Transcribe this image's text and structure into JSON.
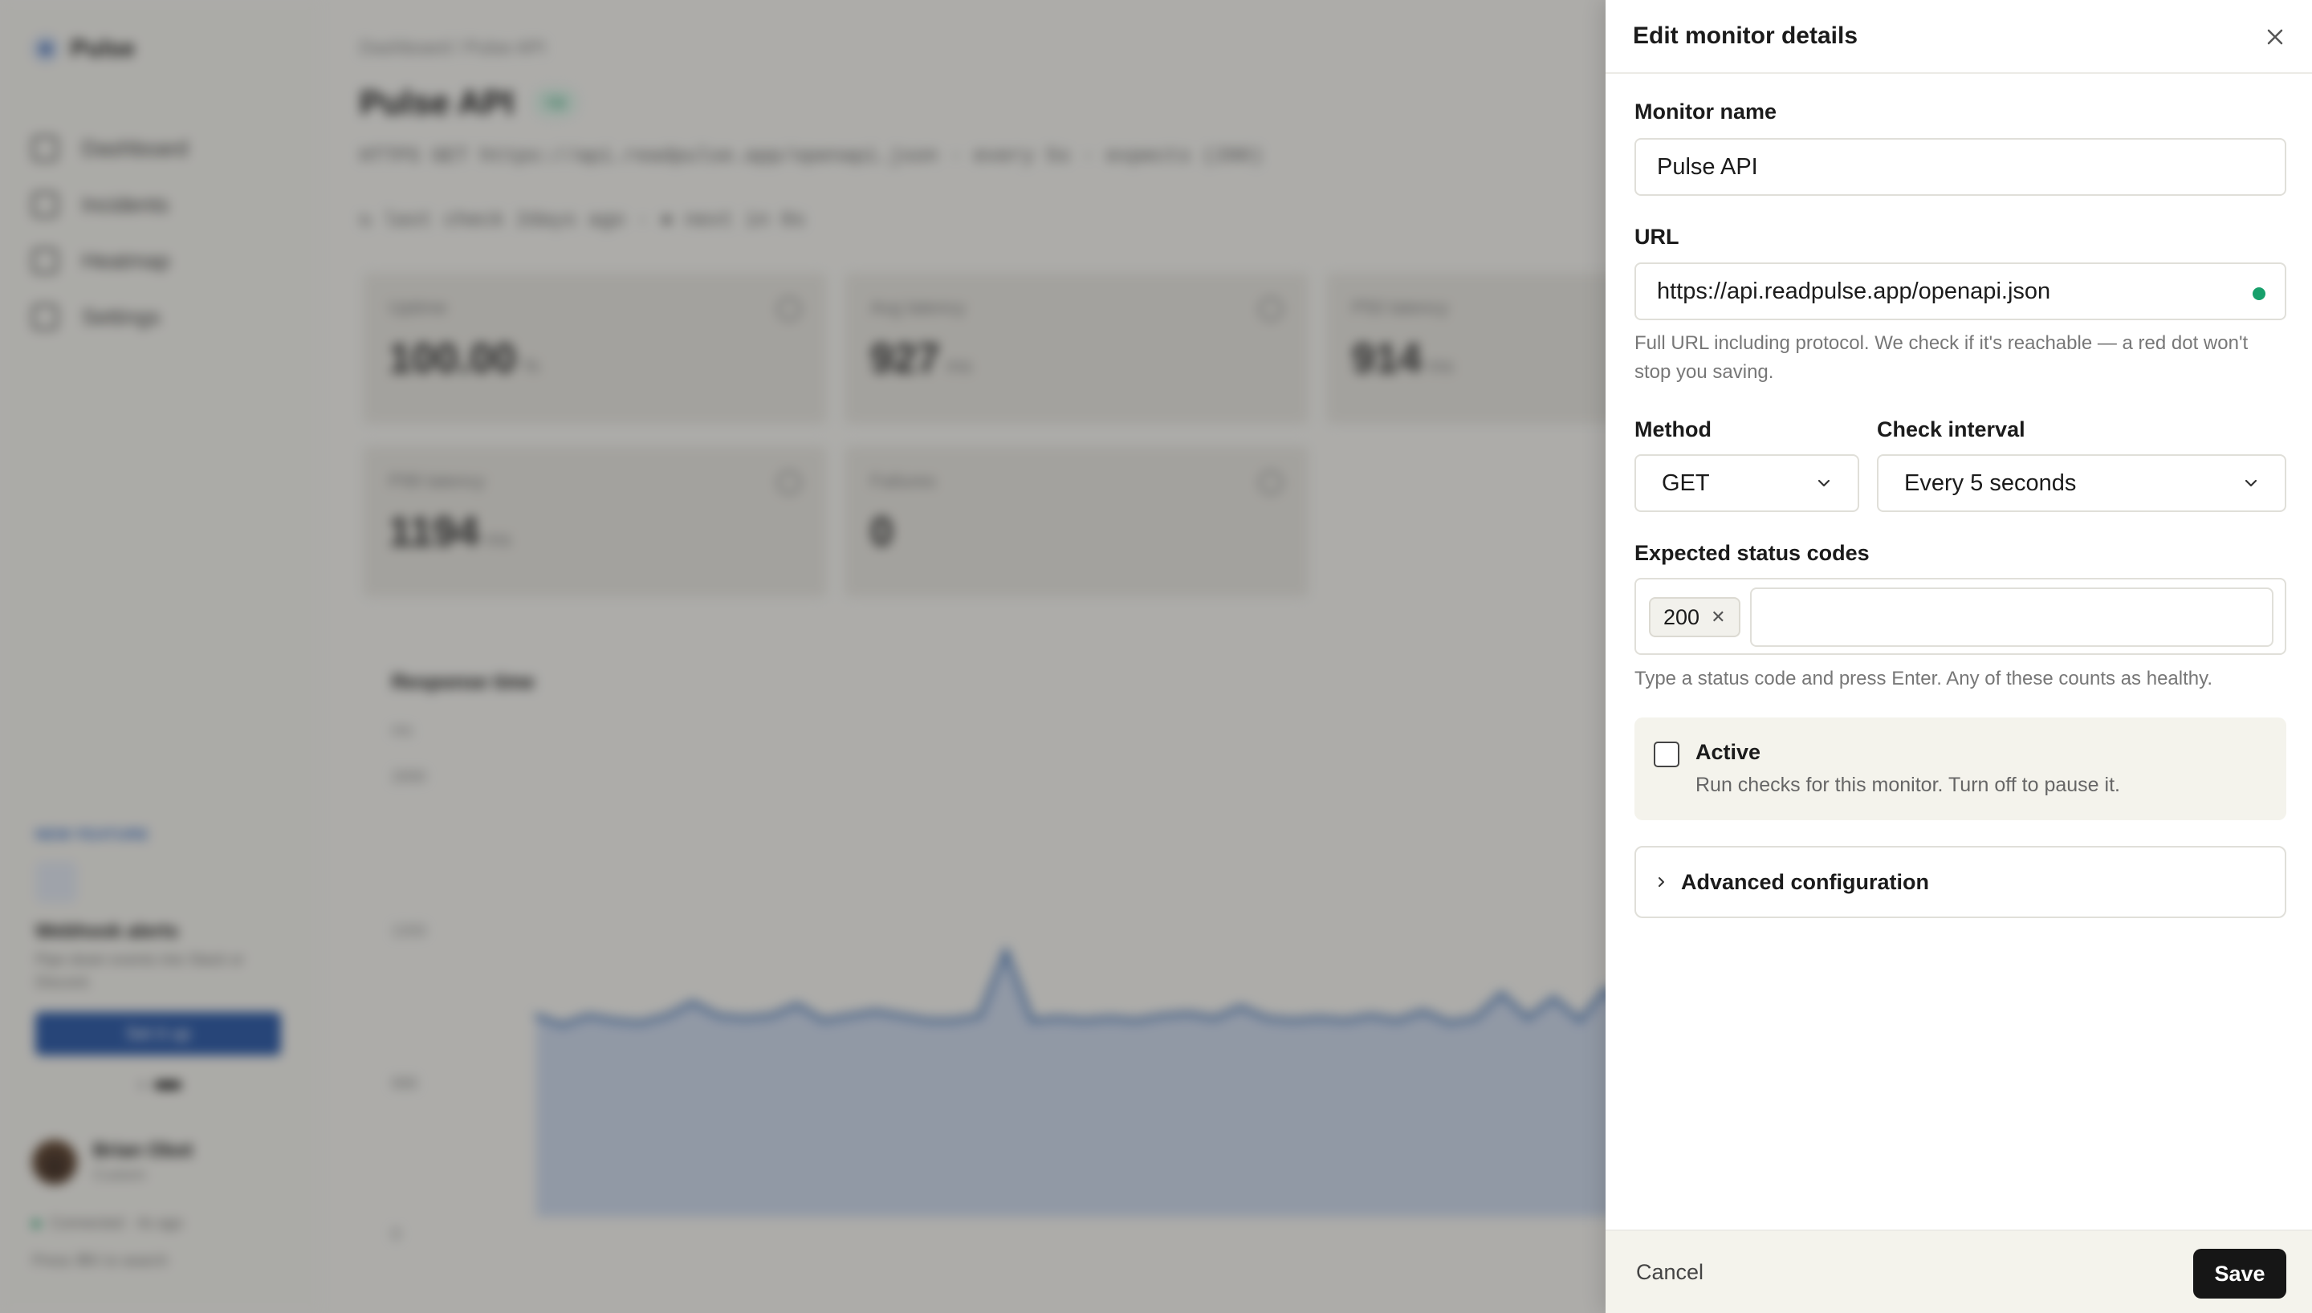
{
  "app": {
    "brand": "Pulse",
    "nav": [
      {
        "label": "Dashboard",
        "icon": "grid-icon"
      },
      {
        "label": "Incidents",
        "icon": "warning-icon"
      },
      {
        "label": "Heatmap",
        "icon": "flame-icon"
      },
      {
        "label": "Settings",
        "icon": "gear-icon"
      }
    ],
    "promo": {
      "tag": "NEW FEATURE",
      "title": "Webhook alerts",
      "desc": "Pipe down events into Slack or Discord.",
      "button": "Set it up"
    },
    "user": {
      "name": "Brian Obot",
      "role": "Custom"
    },
    "connection": "Connected · 4s ago",
    "search_hint": "Press ⌘K to search"
  },
  "monitor": {
    "breadcrumb": "Dashboard / Pulse API",
    "title": "Pulse API",
    "status": "Up",
    "summary": "HTTPS GET https://api.readpulse.app/openapi.json · every 5s · expects (200)",
    "check_line": "↻ last check 2days ago · ● next in 0s",
    "stats": [
      {
        "label": "Uptime",
        "value": "100.00",
        "unit": "%"
      },
      {
        "label": "Avg latency",
        "value": "927",
        "unit": "ms"
      },
      {
        "label": "P50 latency",
        "value": "914",
        "unit": "ms"
      },
      {
        "label": "P99 latency",
        "value": "1194",
        "unit": "ms"
      },
      {
        "label": "Failures",
        "value": "0",
        "unit": ""
      }
    ],
    "chart_title": "Response time",
    "chart_unit": "ms",
    "chart_ticks": [
      "2000",
      "1333",
      "666",
      "0"
    ]
  },
  "chart_data": {
    "type": "area",
    "title": "Response time",
    "ylabel": "ms",
    "ylim": [
      0,
      2000
    ],
    "values": [
      900,
      860,
      900,
      880,
      870,
      900,
      960,
      900,
      890,
      900,
      950,
      880,
      900,
      920,
      900,
      880,
      880,
      900,
      1190,
      880,
      890,
      880,
      890,
      880,
      900,
      910,
      890,
      940,
      890,
      880,
      890,
      880,
      900,
      880,
      920,
      870,
      890,
      1000,
      890,
      980,
      880,
      1020,
      880,
      1000,
      880,
      900,
      1200,
      920,
      880
    ],
    "series_color": "#3b6db3"
  },
  "drawer": {
    "title": "Edit monitor details",
    "name_label": "Monitor name",
    "name_value": "Pulse API",
    "url_label": "URL",
    "url_value": "https://api.readpulse.app/openapi.json",
    "url_help": "Full URL including protocol. We check if it's reachable — a red dot won't stop you saving.",
    "method_label": "Method",
    "method_value": "GET",
    "interval_label": "Check interval",
    "interval_value": "Every 5 seconds",
    "codes_label": "Expected status codes",
    "codes": [
      "200"
    ],
    "codes_help": "Type a status code and press Enter. Any of these counts as healthy.",
    "active_label": "Active",
    "active_desc": "Run checks for this monitor. Turn off to pause it.",
    "advanced_label": "Advanced configuration",
    "cancel_label": "Cancel",
    "save_label": "Save",
    "url_status_color": "#17a06b"
  }
}
